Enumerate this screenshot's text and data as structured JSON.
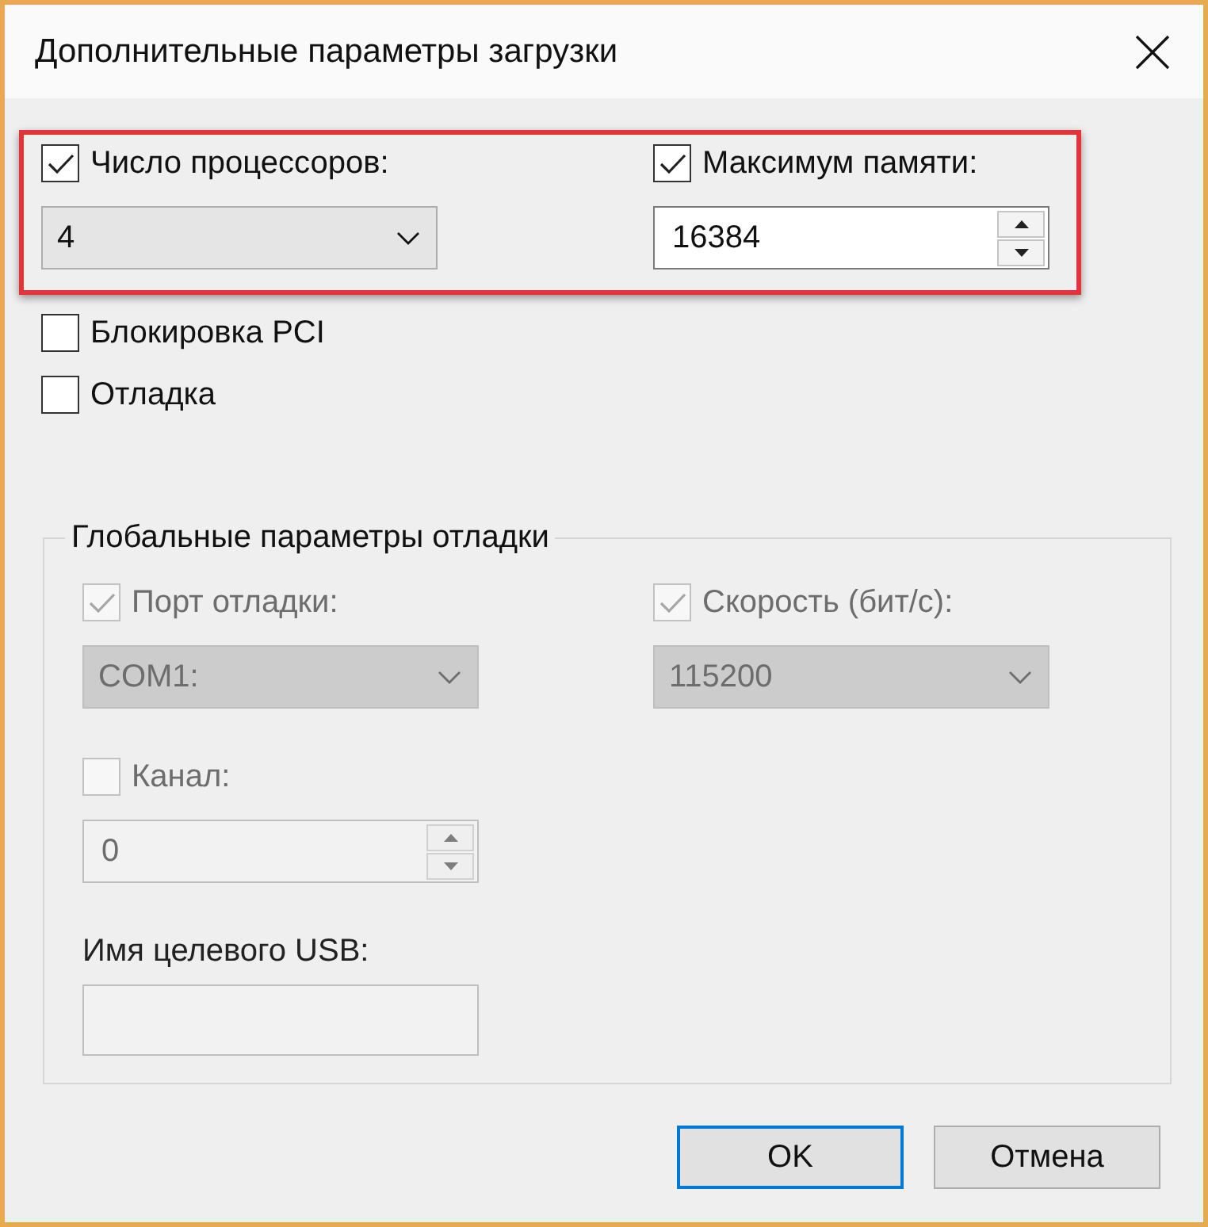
{
  "window": {
    "title": "Дополнительные параметры загрузки"
  },
  "top_row": {
    "highlighted": true,
    "fields": [
      {
        "kind": "dropdown",
        "label": "Число процессоров:",
        "checked": true,
        "value": "4"
      },
      {
        "kind": "spinner",
        "label": "Максимум памяти:",
        "checked": true,
        "value": "16384"
      }
    ]
  },
  "options": [
    {
      "label": "Блокировка PCI",
      "checked": false
    },
    {
      "label": "Отладка",
      "checked": false
    }
  ],
  "debug_group": {
    "title": "Глобальные параметры отладки",
    "disabled": true,
    "rows": [
      [
        {
          "kind": "dropdown",
          "label": "Порт отладки:",
          "checked": true,
          "value": "COM1:"
        },
        {
          "kind": "dropdown",
          "label": "Скорость (бит/с):",
          "checked": true,
          "value": "115200"
        }
      ],
      [
        {
          "kind": "spinner",
          "label": "Канал:",
          "checked": false,
          "value": "0"
        }
      ],
      [
        {
          "kind": "text",
          "label": "Имя целевого USB:"
        }
      ]
    ]
  },
  "buttons": [
    {
      "label": "OK",
      "default": true
    },
    {
      "label": "Отмена",
      "default": false
    }
  ]
}
